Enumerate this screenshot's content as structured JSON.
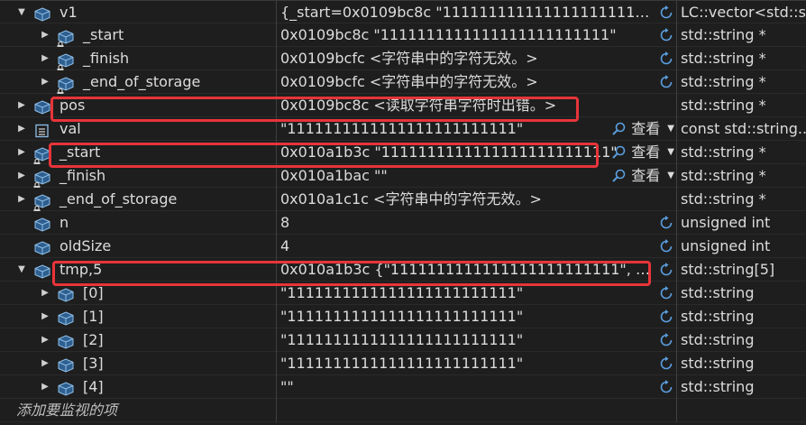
{
  "colors": {
    "background": "#1e1e1e",
    "text": "#dcdcdc",
    "highlight": "#e8343a",
    "icon": "#6a9fd8"
  },
  "rows": [
    {
      "expander": "▼",
      "icon": "cube-icon",
      "locked": false,
      "indent": 0,
      "name": "v1",
      "value": "{_start=0x0109bc8c \"1111111111111111111111111\" ...}",
      "action": "refresh-icon",
      "type": "LC::vector<std::s..."
    },
    {
      "expander": "▶",
      "icon": "cube-icon",
      "locked": true,
      "indent": 1,
      "name": "_start",
      "value": "0x0109bc8c \"1111111111111111111111111\"",
      "action": "refresh-icon",
      "type": "std::string *"
    },
    {
      "expander": "▶",
      "icon": "cube-icon",
      "locked": true,
      "indent": 1,
      "name": "_finish",
      "value": "0x0109bcfc <字符串中的字符无效。>",
      "action": "refresh-icon",
      "type": "std::string *"
    },
    {
      "expander": "▶",
      "icon": "cube-icon",
      "locked": true,
      "indent": 1,
      "name": "_end_of_storage",
      "value": "0x0109bcfc <字符串中的字符无效。>",
      "action": "refresh-icon",
      "type": "std::string *"
    },
    {
      "expander": "▶",
      "icon": "cube-icon",
      "locked": false,
      "indent": 0,
      "name": "pos",
      "value": "0x0109bc8c <读取字符串字符时出错。>",
      "action": "",
      "type": "std::string *"
    },
    {
      "expander": "▶",
      "icon": "field-icon",
      "locked": false,
      "indent": 0,
      "name": "val",
      "value": "\"1111111111111111111111111\"",
      "action": "view",
      "type": "const std::string..."
    },
    {
      "expander": "▶",
      "icon": "cube-icon",
      "locked": true,
      "indent": 0,
      "name": "_start",
      "value": "0x010a1b3c \"1111111111111111111111111\"",
      "action": "view",
      "type": "std::string *"
    },
    {
      "expander": "▶",
      "icon": "cube-icon",
      "locked": true,
      "indent": 0,
      "name": "_finish",
      "value": "0x010a1bac \"\"",
      "action": "view",
      "type": "std::string *"
    },
    {
      "expander": "▶",
      "icon": "cube-icon",
      "locked": true,
      "indent": 0,
      "name": "_end_of_storage",
      "value": "0x010a1c1c <字符串中的字符无效。>",
      "action": "",
      "type": "std::string *"
    },
    {
      "expander": "",
      "icon": "cube-icon",
      "locked": false,
      "indent": 0,
      "name": "n",
      "value": "8",
      "action": "refresh-icon",
      "type": "unsigned int"
    },
    {
      "expander": "",
      "icon": "cube-icon",
      "locked": false,
      "indent": 0,
      "name": "oldSize",
      "value": "4",
      "action": "refresh-icon",
      "type": "unsigned int"
    },
    {
      "expander": "▼",
      "icon": "cube-icon",
      "locked": false,
      "indent": 0,
      "name": "tmp,5",
      "value": "0x010a1b3c {\"1111111111111111111111111\", \"1111111111111111111111111\", ...}",
      "action": "refresh-icon",
      "type": "std::string[5]"
    },
    {
      "expander": "▶",
      "icon": "cube-icon",
      "locked": false,
      "indent": 1,
      "name": "[0]",
      "value": "\"1111111111111111111111111\"",
      "action": "refresh-icon",
      "type": "std::string"
    },
    {
      "expander": "▶",
      "icon": "cube-icon",
      "locked": false,
      "indent": 1,
      "name": "[1]",
      "value": "\"1111111111111111111111111\"",
      "action": "refresh-icon",
      "type": "std::string"
    },
    {
      "expander": "▶",
      "icon": "cube-icon",
      "locked": false,
      "indent": 1,
      "name": "[2]",
      "value": "\"1111111111111111111111111\"",
      "action": "refresh-icon",
      "type": "std::string"
    },
    {
      "expander": "▶",
      "icon": "cube-icon",
      "locked": false,
      "indent": 1,
      "name": "[3]",
      "value": "\"1111111111111111111111111\"",
      "action": "refresh-icon",
      "type": "std::string"
    },
    {
      "expander": "▶",
      "icon": "cube-icon",
      "locked": false,
      "indent": 1,
      "name": "[4]",
      "value": "\"\"",
      "action": "refresh-icon",
      "type": "std::string"
    }
  ],
  "view_label": "查看",
  "add_watch_label": "添加要监视的项"
}
